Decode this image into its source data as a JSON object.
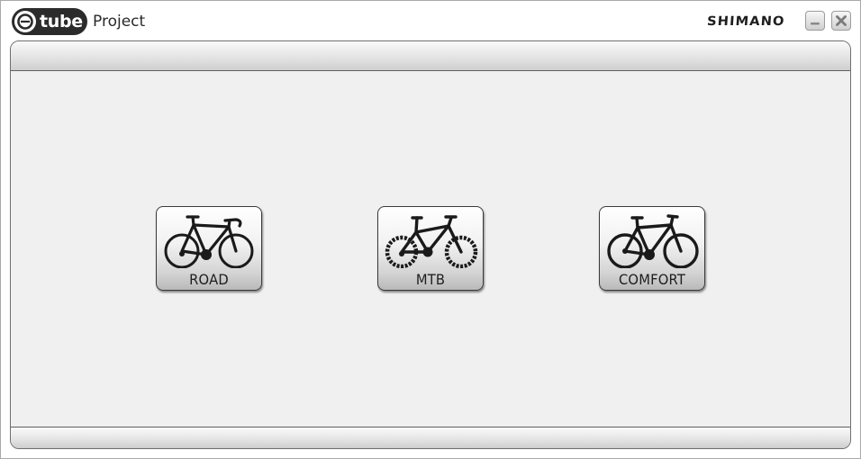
{
  "titlebar": {
    "logo_text": "tube",
    "logo_icon": "e-tube-logo-icon",
    "title": "Project",
    "brand": "SHIMANO",
    "minimize_icon": "minimize-icon",
    "close_icon": "close-icon"
  },
  "bikes": [
    {
      "label": "ROAD",
      "icon": "road-bike-icon"
    },
    {
      "label": "MTB",
      "icon": "mountain-bike-icon"
    },
    {
      "label": "COMFORT",
      "icon": "comfort-bike-icon"
    }
  ],
  "colors": {
    "panel_bg": "#f0f0f0",
    "icon": "#1a1a1a",
    "border": "#6f6f6f"
  }
}
